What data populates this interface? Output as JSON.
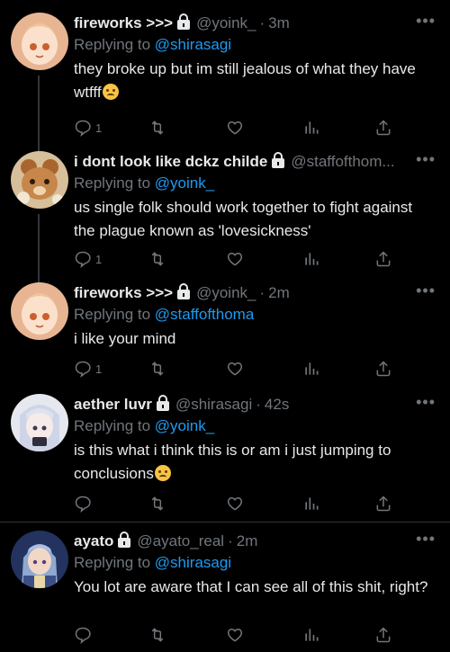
{
  "tweets": [
    {
      "name": "fireworks >>>",
      "handle": "@yoink_",
      "time": "3m",
      "replying_prefix": "Replying to",
      "replying_to": "@shirasagi",
      "text": "they broke up but im still jealous of what they have wtfff",
      "emoji": "weary-face",
      "replies": "1",
      "avatar_colors": {
        "skin": "#fbe1cc",
        "hair": "#f3c9a8",
        "bg": "#e9b99a"
      }
    },
    {
      "name": "i dont look like dckz childe",
      "handle": "@staffofthom...",
      "time": "",
      "replying_prefix": "Replying to",
      "replying_to": "@yoink_",
      "text": "us single folk should work together to fight against the plague known as 'lovesickness'",
      "emoji": "",
      "replies": "1",
      "avatar_colors": {
        "skin": "#c98b4c",
        "hair": "#8a5a2b",
        "bg": "#d8c2a0"
      }
    },
    {
      "name": "fireworks >>>",
      "handle": "@yoink_",
      "time": "2m",
      "replying_prefix": "Replying to",
      "replying_to": "@staffofthoma",
      "text": "i like your mind",
      "emoji": "",
      "replies": "1",
      "avatar_colors": {
        "skin": "#fbe1cc",
        "hair": "#f3c9a8",
        "bg": "#e9b99a"
      }
    },
    {
      "name": "aether luvr",
      "handle": "@shirasagi",
      "time": "42s",
      "replying_prefix": "Replying to",
      "replying_to": "@yoink_",
      "text": "is this what i think this is or am i just jumping to conclusions",
      "emoji": "persevering-face",
      "replies": "",
      "avatar_colors": {
        "skin": "#f4e6e4",
        "hair": "#dfe3ef",
        "bg": "#c9cfe0"
      }
    },
    {
      "name": "ayato",
      "handle": "@ayato_real",
      "time": "2m",
      "replying_prefix": "Replying to",
      "replying_to": "@shirasagi",
      "text": "You lot are aware that I can see all of this shit, right?",
      "emoji": "",
      "replies": "",
      "avatar_colors": {
        "skin": "#f1d8c6",
        "hair": "#9fb7d9",
        "bg": "#2a3c6b"
      }
    }
  ],
  "more_label": "•••",
  "icons": [
    "reply-icon",
    "retweet-icon",
    "like-icon",
    "views-icon",
    "share-icon",
    "lock-icon",
    "more-icon"
  ],
  "colors": {
    "background": "#000000",
    "text": "#e7e9ea",
    "muted": "#71767b",
    "link": "#1d9bf0",
    "divider": "#2f3336"
  }
}
